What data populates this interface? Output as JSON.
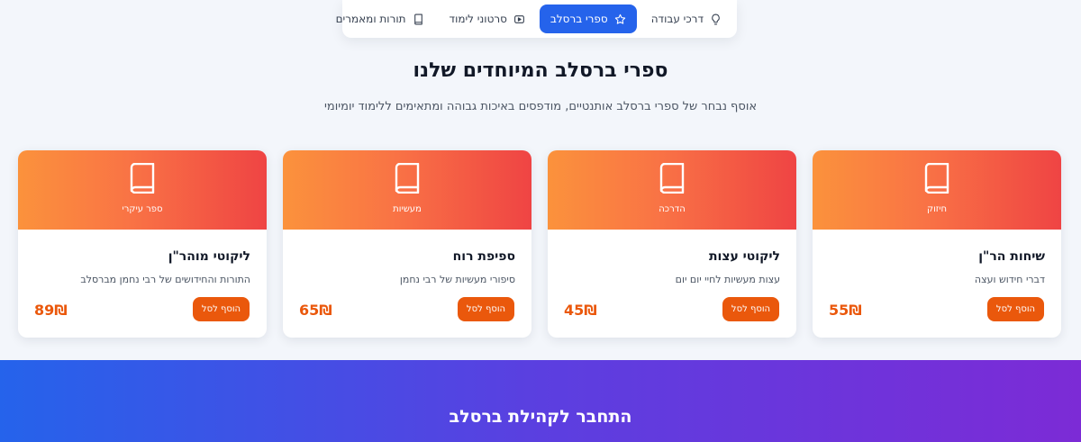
{
  "tabs": [
    {
      "label": "דרכי עבודה",
      "icon": "lightbulb-icon",
      "active": false
    },
    {
      "label": "ספרי ברסלב",
      "icon": "star-icon",
      "active": true
    },
    {
      "label": "סרטוני לימוד",
      "icon": "play-video-icon",
      "active": false
    },
    {
      "label": "תורות ומאמרים",
      "icon": "book-icon",
      "active": false
    }
  ],
  "section": {
    "title": "ספרי ברסלב המיוחדים שלנו",
    "subtitle": "אוסף נבחר של ספרי ברסלב אותנטיים, מודפסים באיכות גבוהה ומתאימים ללימוד יומיומי"
  },
  "books": [
    {
      "category": "חיזוק",
      "title": "שיחות הר\"ן",
      "description": "דברי חידוש ועצה",
      "price": "55₪",
      "button": "הוסף לסל"
    },
    {
      "category": "הדרכה",
      "title": "ליקוטי עצות",
      "description": "עצות מעשיות לחיי יום יום",
      "price": "45₪",
      "button": "הוסף לסל"
    },
    {
      "category": "מעשיות",
      "title": "ספיפת רוח",
      "description": "סיפורי מעשיות של רבי נחמן",
      "price": "65₪",
      "button": "הוסף לסל"
    },
    {
      "category": "ספר עיקרי",
      "title": "ליקוטי מוהר\"ן",
      "description": "התורות והחידושים של רבי נחמן מברסלב",
      "price": "89₪",
      "button": "הוסף לסל"
    }
  ],
  "community": {
    "title": "התחבר לקהילת ברסלב"
  },
  "colors": {
    "accent": "#2563eb",
    "card_gradient_start": "#fb923c",
    "card_gradient_end": "#ef4444",
    "price": "#ea580c",
    "banner_start": "#2563eb",
    "banner_end": "#7c2bd6"
  }
}
